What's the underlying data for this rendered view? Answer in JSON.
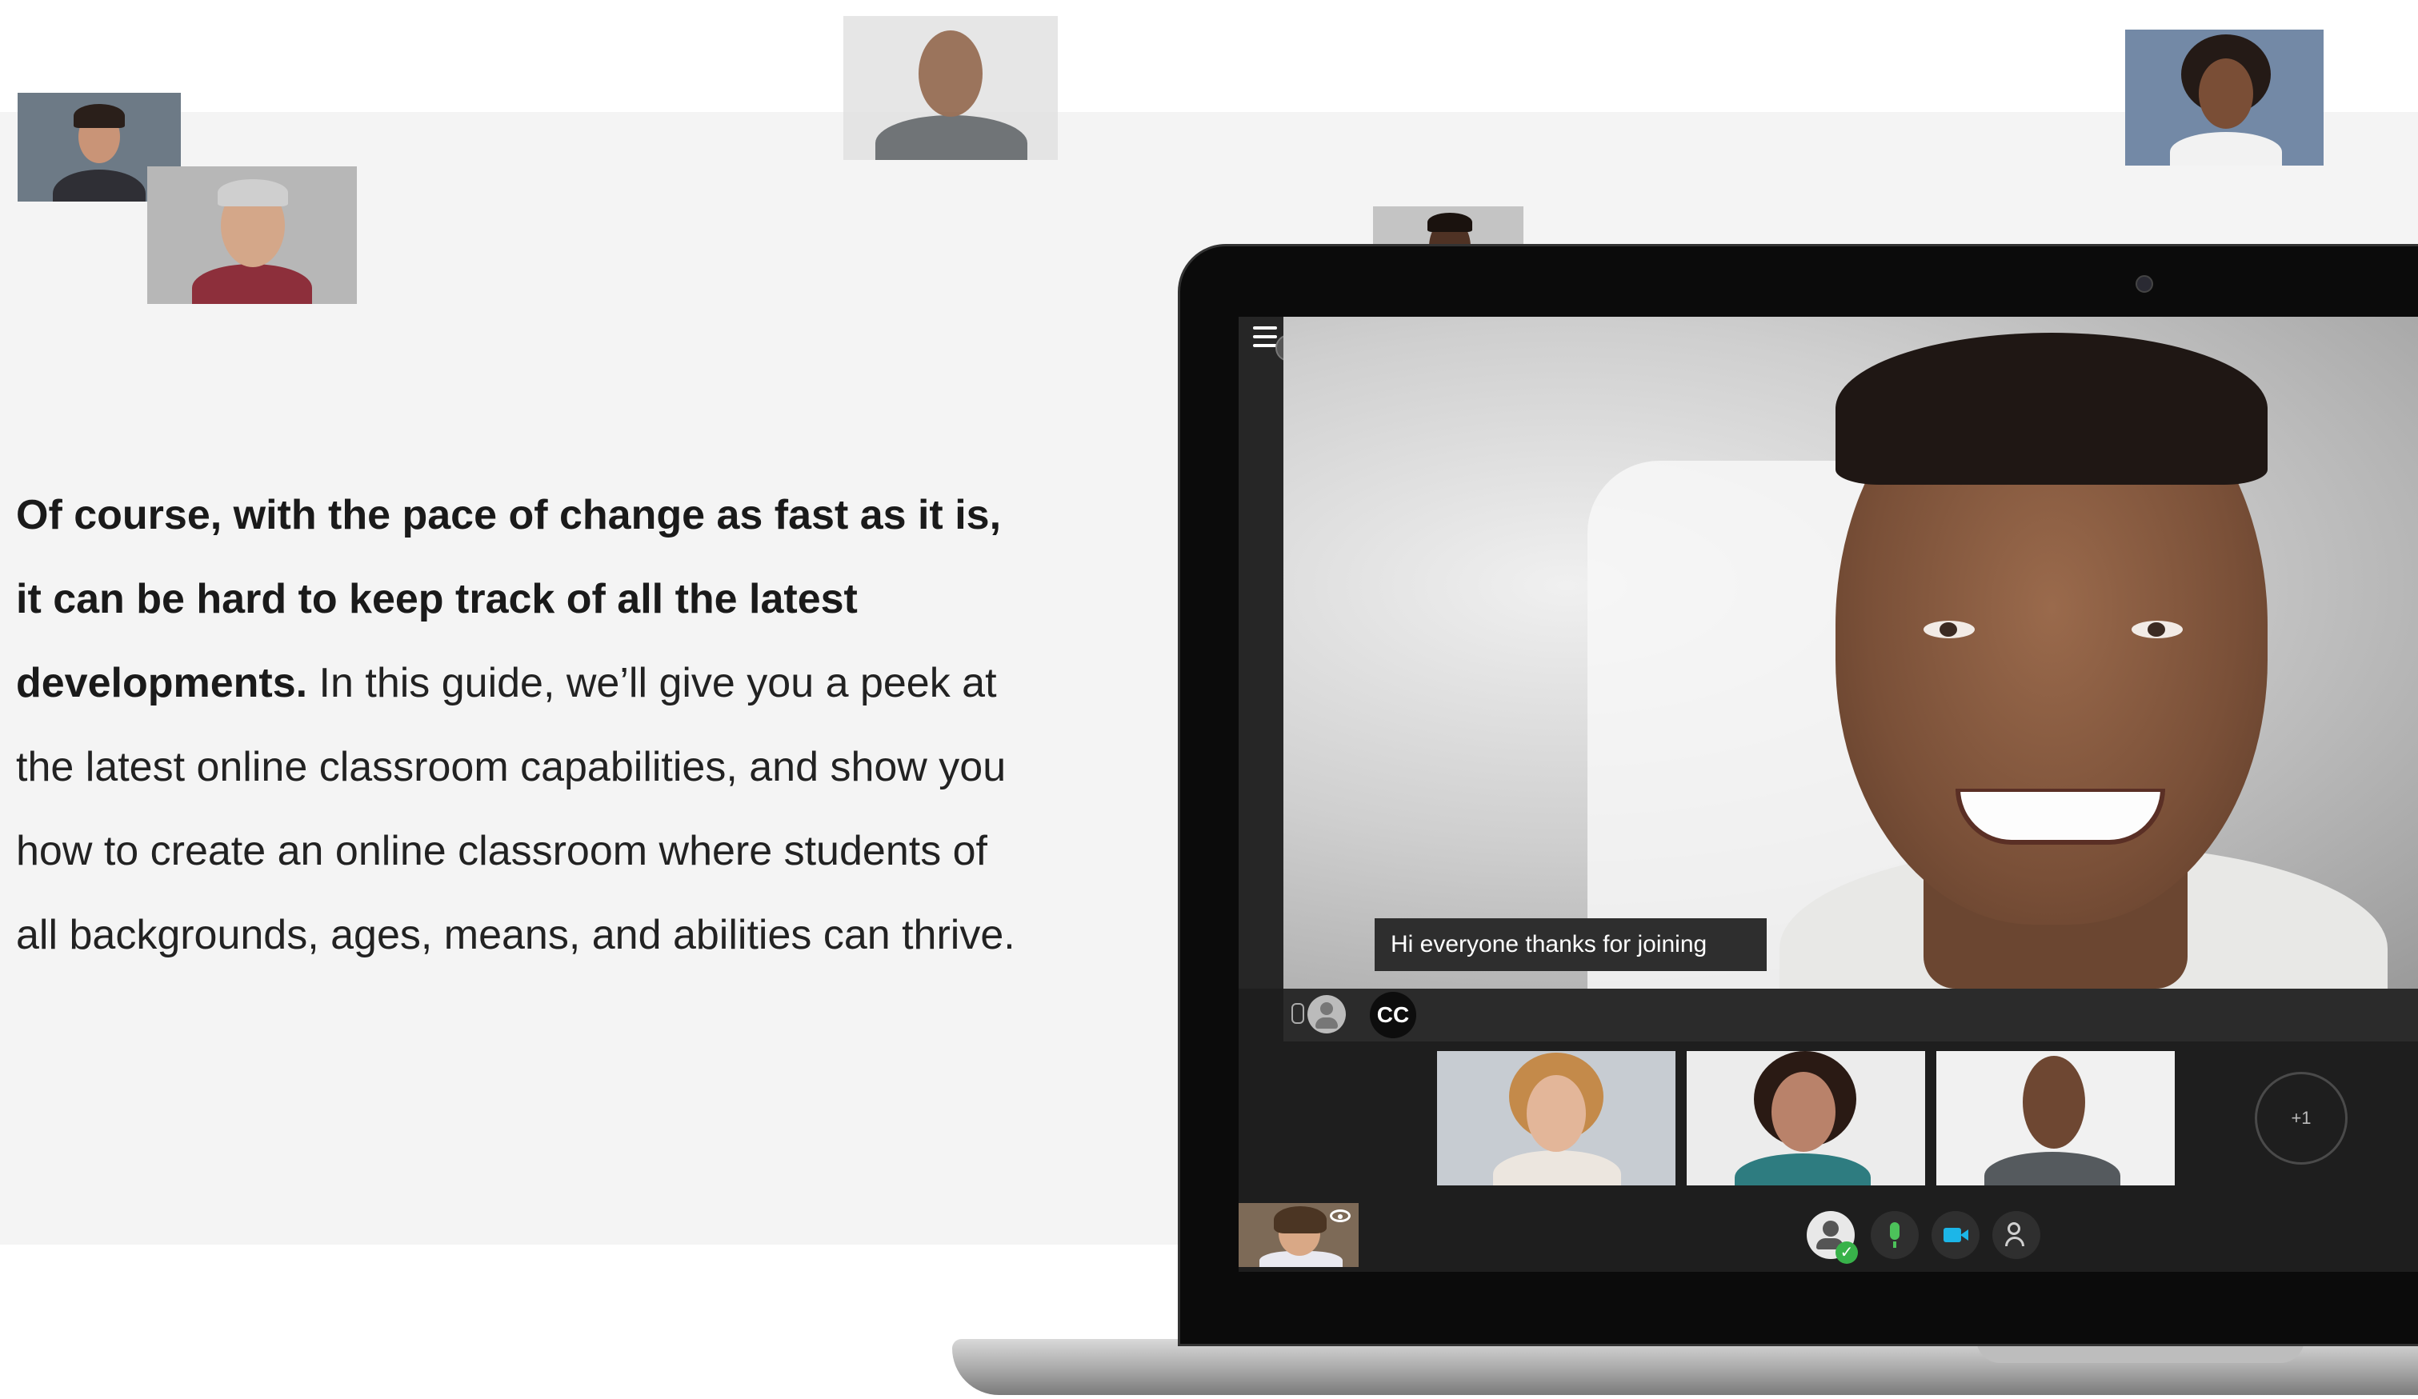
{
  "intro": {
    "bold_text": "Of course, with the pace of change as fast as it is, it can be hard to keep track of all the latest developments.",
    "regular_text": " In this guide, we’ll give you a peek at the latest online classroom capabilities, and show you how to create an online classroom where students of all backgrounds, ages, means, and abilities can thrive."
  },
  "collaborate": {
    "caption": "Hi everyone thanks for joining",
    "cc_label": "CC",
    "more_participants": "+1",
    "status_check": "✓"
  },
  "colors": {
    "page_background": "#ffffff",
    "band_background": "#f4f4f4",
    "screen_background": "#1e1e1e",
    "accent_green": "#38b24a",
    "accent_blue": "#1cb6e8"
  },
  "icons": {
    "menu": "menu-icon",
    "recording": "recording-icon",
    "microphone": "microphone-icon",
    "avatar": "user-avatar-icon",
    "closed_captions": "cc-icon",
    "visibility": "eye-icon",
    "status": "user-status-icon",
    "camera": "camera-icon",
    "share": "share-icon"
  }
}
